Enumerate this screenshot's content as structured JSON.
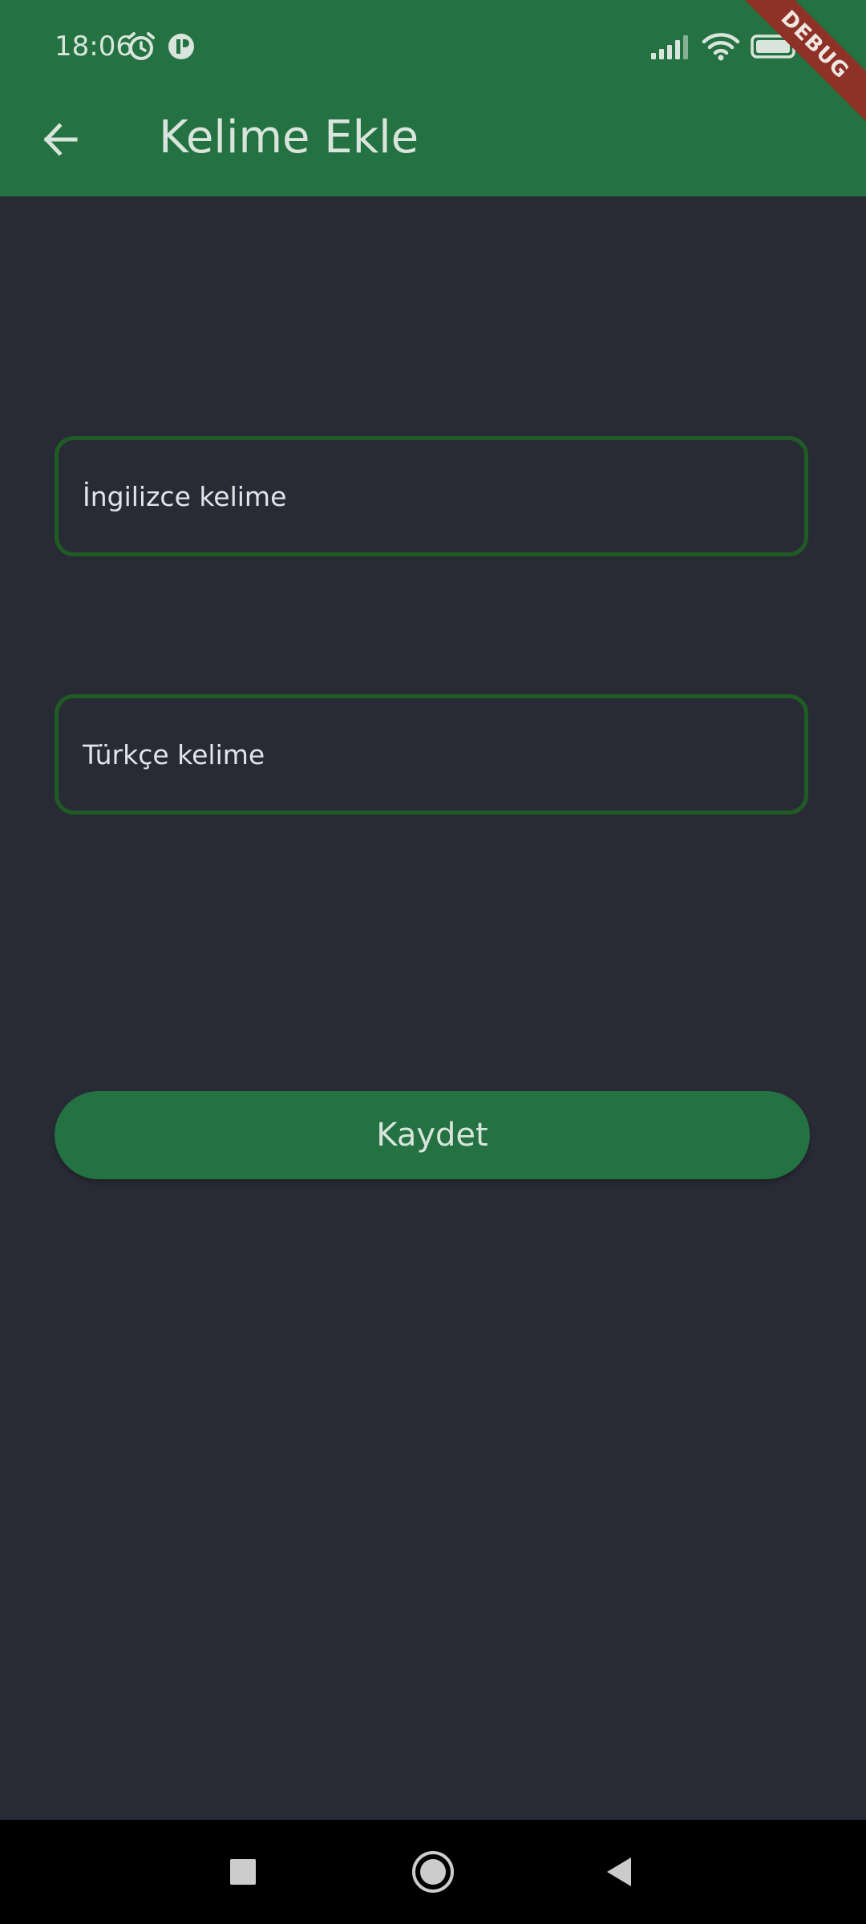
{
  "status_bar": {
    "time": "18:06",
    "icons": [
      "alarm-icon",
      "vpn-icon",
      "signal-icon",
      "wifi-icon",
      "battery-icon"
    ]
  },
  "app_bar": {
    "title": "Kelime Ekle",
    "back_icon": "arrow-left-icon",
    "color": "#247141"
  },
  "debug_banner": {
    "label": "DEBUG",
    "color": "#8E3228"
  },
  "form": {
    "english_placeholder": "İngilizce kelime",
    "turkish_placeholder": "Türkçe kelime",
    "field_border_color": "#1F5C23",
    "save_label": "Kaydet"
  },
  "nav_bar": {
    "icons": [
      "recents-square-icon",
      "home-circle-icon",
      "back-triangle-icon"
    ]
  },
  "colors": {
    "background": "#282B36",
    "primary": "#247141",
    "text": "#D9E5DC"
  }
}
